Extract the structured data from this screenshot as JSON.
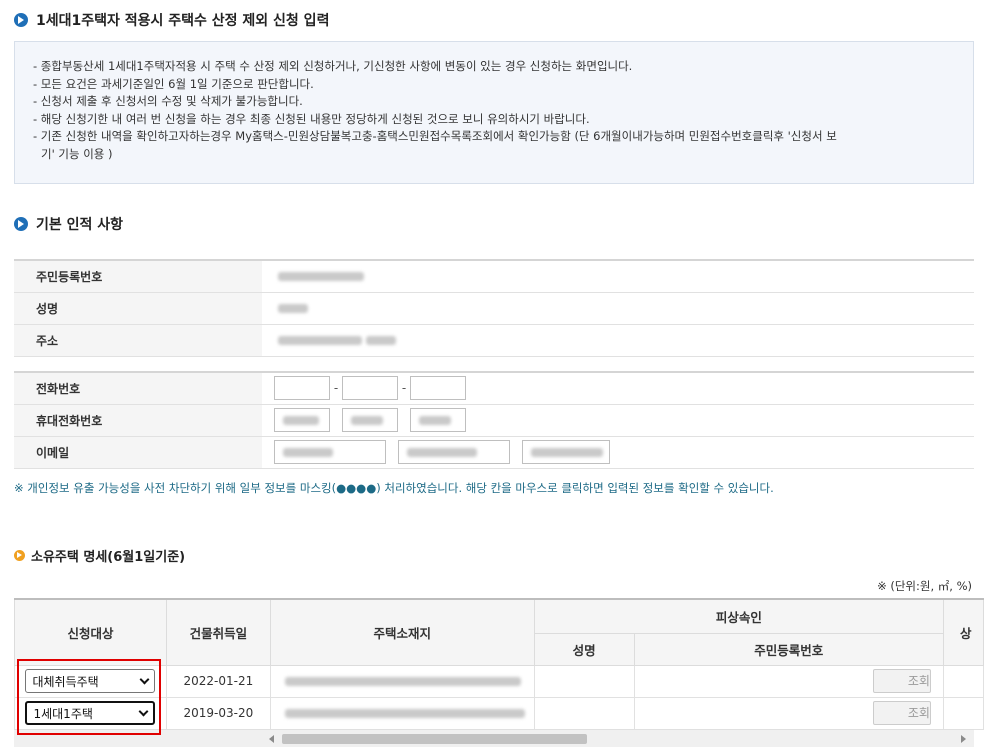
{
  "section1": {
    "title": "1세대1주택자 적용시 주택수 산정 제외 신청 입력",
    "notices": [
      "- 종합부동산세 1세대1주택자적용 시 주택 수 산정 제외 신청하거나, 기신청한 사항에 변동이 있는 경우 신청하는 화면입니다.",
      "- 모든 요건은 과세기준일인 6월 1일 기준으로 판단합니다.",
      "- 신청서 제출 후 신청서의 수정 및 삭제가 불가능합니다.",
      "- 해당 신청기한 내 여러 번 신청을 하는 경우 최종 신청된 내용만 정당하게 신청된 것으로 보니 유의하시기 바랍니다.",
      "- 기존 신청한 내역을 확인하고자하는경우 My홈택스-민원상담불복고충-홈택스민원접수목록조회에서 확인가능함 (단 6개월이내가능하며 민원접수번호클릭후 '신청서 보",
      "  기' 기능 이용 )"
    ]
  },
  "section2": {
    "title": "기본 인적 사항",
    "labels": {
      "rrn": "주민등록번호",
      "name": "성명",
      "address": "주소",
      "phone": "전화번호",
      "mobile": "휴대전화번호",
      "email": "이메일"
    },
    "phone_sep": "-",
    "mask_note": "※ 개인정보 유출 가능성을 사전 차단하기 위해 일부 정보를 마스킹(●●●●) 처리하였습니다. 해당 칸을 마우스로 클릭하면 입력된 정보를 확인할 수 있습니다."
  },
  "section3": {
    "title": "소유주택 명세(6월1일기준)",
    "unit_note": "※ (단위:원, ㎡, %)",
    "headers": {
      "target": "신청대상",
      "acquired": "건물취득일",
      "location": "주택소재지",
      "heir": "피상속인",
      "heir_name": "성명",
      "heir_rrn": "주민등록번호",
      "cut": "상"
    },
    "rows": [
      {
        "target": "대체취득주택",
        "acquired": "2022-01-21",
        "button": "조회"
      },
      {
        "target": "1세대1주택",
        "acquired": "2019-03-20",
        "button": "조회"
      }
    ]
  },
  "colors": {
    "accent": "#1f6fb7",
    "highlight": "#e00000",
    "note": "#1d6a86"
  }
}
